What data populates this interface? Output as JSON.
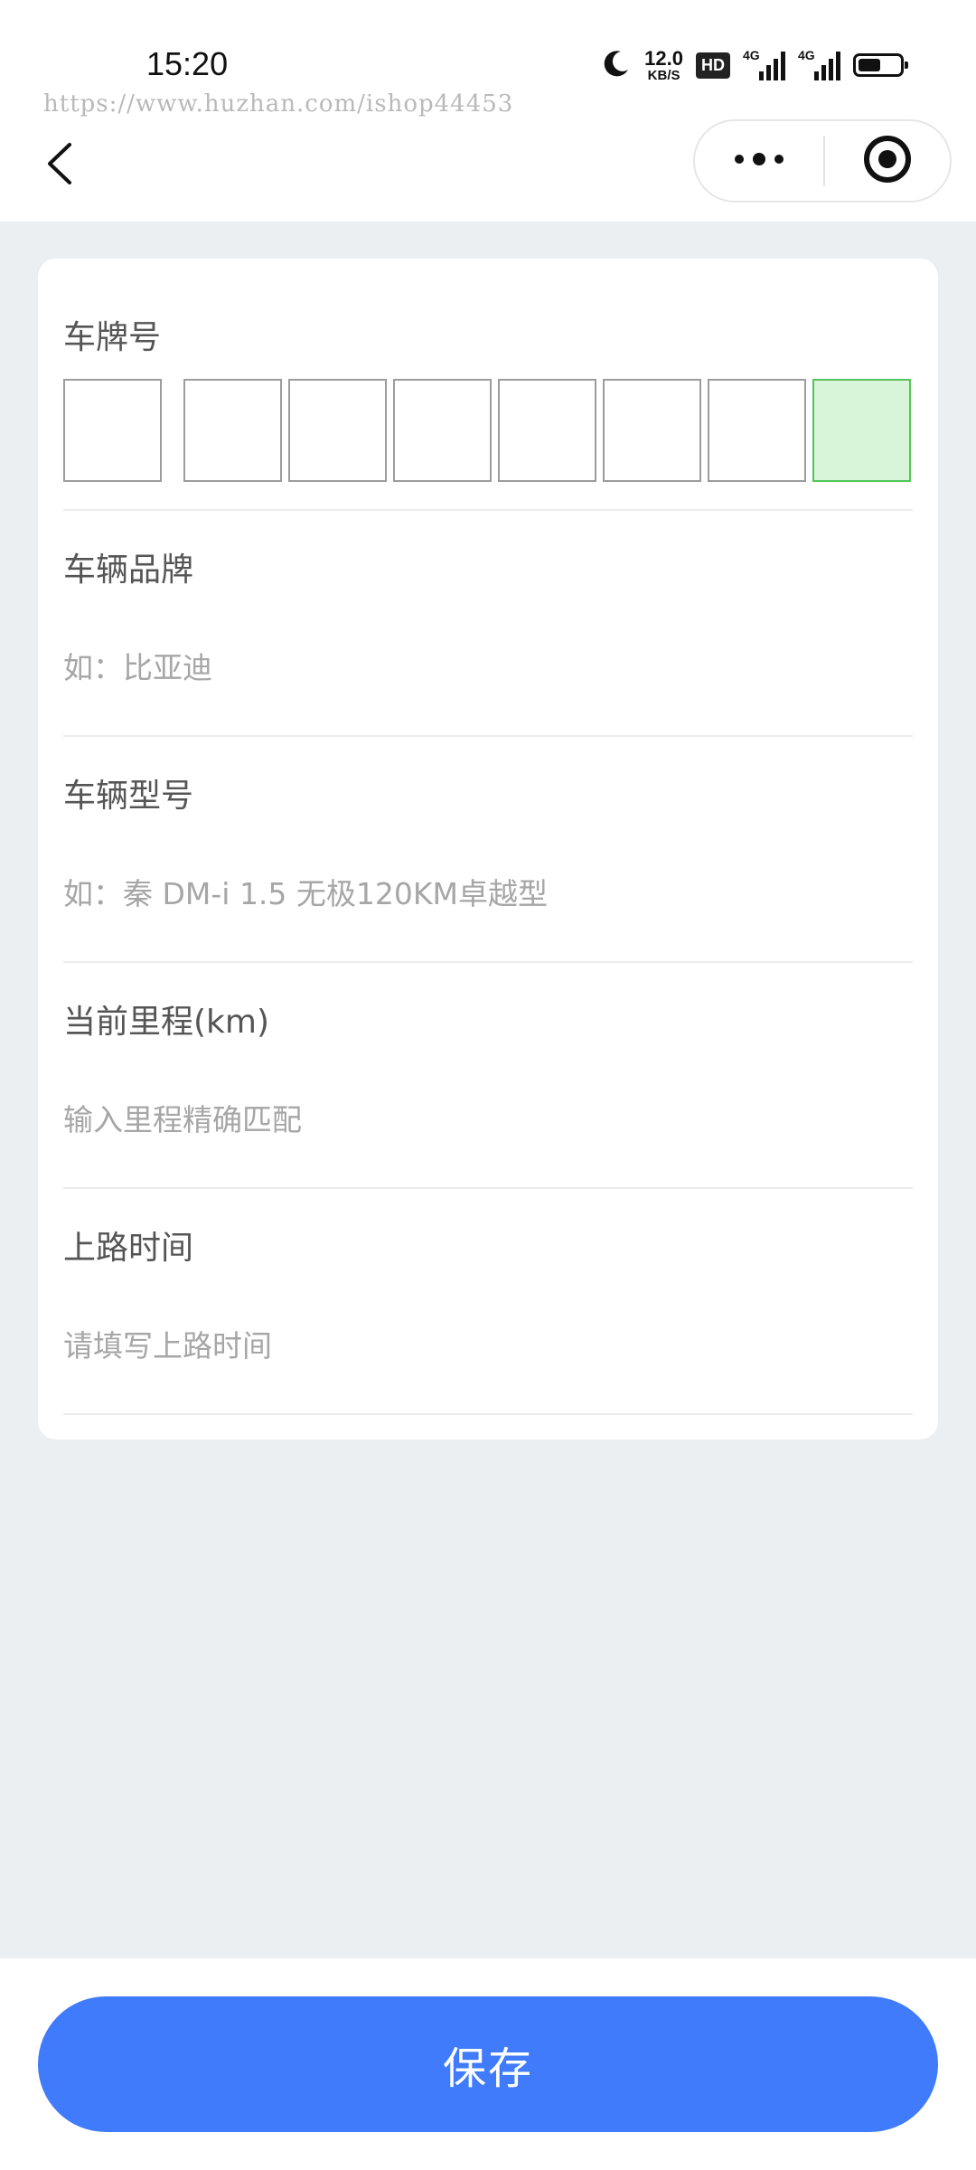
{
  "status_bar": {
    "time": "15:20",
    "net_speed_value": "12.0",
    "net_speed_unit": "KB/S",
    "hd_label": "HD",
    "signal_1_label": "4G",
    "signal_2_label": "4G",
    "icons": [
      "moon-icon",
      "hd-icon",
      "signal-icon",
      "signal-icon",
      "battery-icon"
    ]
  },
  "watermark": "https://www.huzhan.com/ishop44453",
  "nav": {
    "icons": [
      "back-arrow-icon",
      "more-dots-icon",
      "close-target-icon"
    ]
  },
  "form": {
    "plate": {
      "label": "车牌号",
      "box_count": 8,
      "new_energy_box_color": "#d9f5d9"
    },
    "brand": {
      "label": "车辆品牌",
      "placeholder": "如：比亚迪"
    },
    "model": {
      "label": "车辆型号",
      "placeholder": "如：秦 DM-i 1.5 无极120KM卓越型"
    },
    "mileage": {
      "label": "当前里程(km)",
      "placeholder": "输入里程精确匹配"
    },
    "date": {
      "label": "上路时间",
      "placeholder": "请填写上路时间"
    }
  },
  "save_button": {
    "label": "保存",
    "color": "#3f7bfb"
  }
}
